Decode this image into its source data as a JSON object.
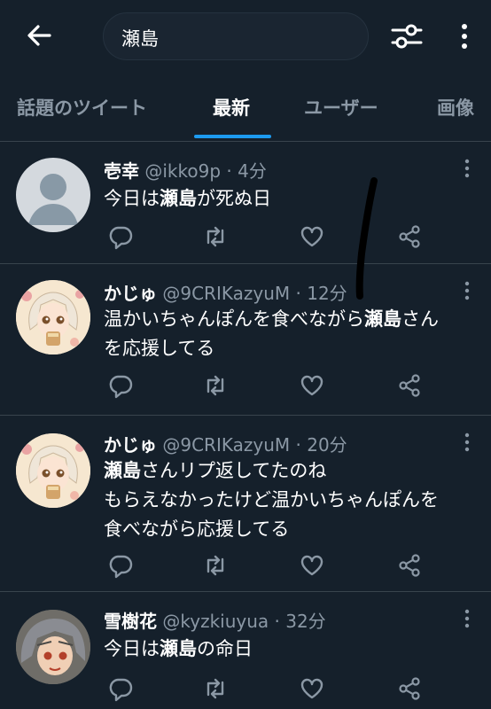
{
  "search": {
    "query": "瀬島"
  },
  "tabs": [
    {
      "label": "話題のツイート",
      "active": false
    },
    {
      "label": "最新",
      "active": true
    },
    {
      "label": "ユーザー",
      "active": false
    },
    {
      "label": "画像",
      "active": false
    }
  ],
  "colors": {
    "background": "#15202b",
    "accent": "#1d9bf0",
    "muted": "#8b98a5",
    "divider": "#38444d"
  },
  "tweets": [
    {
      "name": "壱幸",
      "handle": "@ikko9p",
      "dot": "·",
      "time": "4分",
      "lines": [
        [
          "今日は",
          "瀬島",
          "が死ぬ日"
        ]
      ],
      "avatar": "default-avatar-icon"
    },
    {
      "name": "かじゅ",
      "handle": "@9CRIKazyuM",
      "dot": "·",
      "time": "12分",
      "lines": [
        [
          "温かいちゃんぽんを食べながら",
          "瀬島",
          "さん"
        ],
        [
          "を応援してる",
          "",
          ""
        ]
      ],
      "avatar": "anime-girl-avatar"
    },
    {
      "name": "かじゅ",
      "handle": "@9CRIKazyuM",
      "dot": "·",
      "time": "20分",
      "lines": [
        [
          "",
          "瀬島",
          "さんリプ返してたのね"
        ],
        [
          "もらえなかったけど温かいちゃんぽんを",
          "",
          ""
        ],
        [
          "食べながら応援してる",
          "",
          ""
        ]
      ],
      "avatar": "anime-girl-avatar"
    },
    {
      "name": "雪樹花",
      "handle": "@kyzkiuyua",
      "dot": "·",
      "time": "32分",
      "lines": [
        [
          "今日は",
          "瀬島",
          "の命日"
        ]
      ],
      "avatar": "anime-character-avatar"
    }
  ]
}
